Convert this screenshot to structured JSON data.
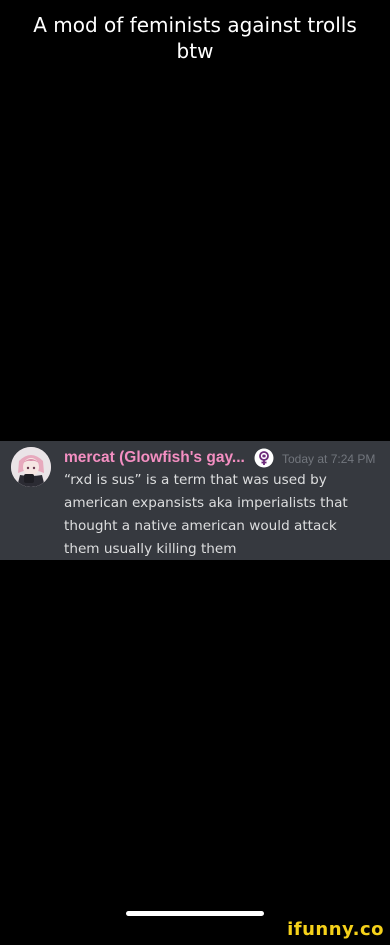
{
  "caption": {
    "line1": "A mod of feminists against trolls",
    "line2": "btw"
  },
  "message": {
    "username": "mercat (Glowfish's gay...",
    "username_color": "#f48fc2",
    "role_icon": "feminism-symbol-icon",
    "timestamp": "Today at 7:24 PM",
    "body_lines": [
      "“rxd is sus” is a term that was used by",
      "american expansists aka imperialists that",
      "thought a native american would attack",
      "them usually killing them"
    ],
    "background_color": "#36393f",
    "avatar_icon": "anime-avatar-icon"
  },
  "watermark": {
    "text": "ifunny.co",
    "color": "#f5d11a"
  }
}
